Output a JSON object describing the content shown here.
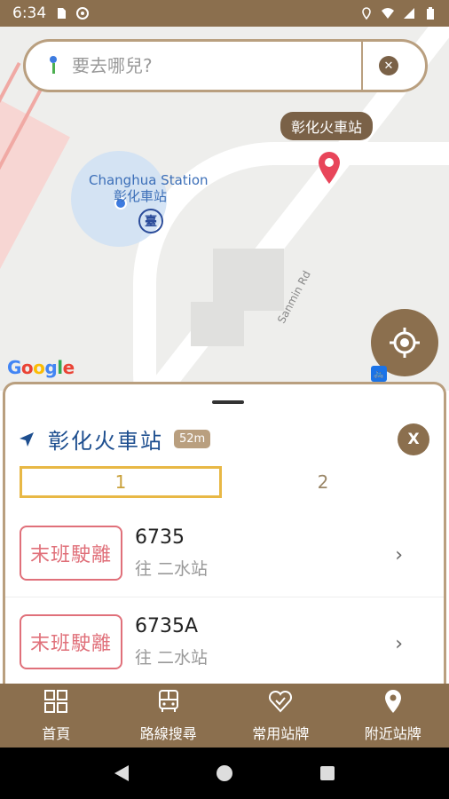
{
  "status_bar": {
    "time": "6:34"
  },
  "map": {
    "station_name_en": "Changhua Station",
    "station_name_zh": "彰化車站",
    "rail_icon_text": "臺",
    "road_label": "Sanmin Rd",
    "poi_label": "彰化火車站",
    "google_letters": [
      "G",
      "o",
      "o",
      "g",
      "l",
      "e"
    ],
    "google_colors": [
      "#4285F4",
      "#EA4335",
      "#FBBC05",
      "#4285F4",
      "#34A853",
      "#EA4335"
    ]
  },
  "search": {
    "placeholder": "要去哪兒?",
    "clear_icon": "close-icon"
  },
  "sheet": {
    "stop_name": "彰化火車站",
    "distance": "52m",
    "close_label": "X",
    "tabs": [
      {
        "label": "1"
      },
      {
        "label": "2"
      }
    ],
    "routes": [
      {
        "status": "末班駛離",
        "number": "6735",
        "destination": "往 二水站"
      },
      {
        "status": "末班駛離",
        "number": "6735A",
        "destination": "往 二水站"
      }
    ]
  },
  "bottom_nav": {
    "items": [
      {
        "label": "首頁",
        "icon": "grid-icon"
      },
      {
        "label": "路線搜尋",
        "icon": "bus-icon"
      },
      {
        "label": "常用站牌",
        "icon": "heart-icon"
      },
      {
        "label": "附近站牌",
        "icon": "location-pin-icon"
      }
    ]
  },
  "colors": {
    "accent": "#8b6f4e",
    "border": "#b99f7f",
    "alert": "#e0707a",
    "tab_active": "#e8b845"
  }
}
